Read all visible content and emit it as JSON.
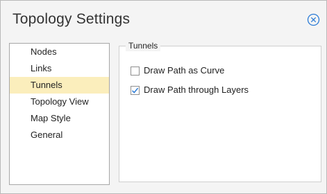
{
  "dialog": {
    "title": "Topology Settings",
    "close_icon": "close-circle-icon",
    "accent_color": "#2b7bd6"
  },
  "sidebar": {
    "items": [
      {
        "label": "Nodes",
        "selected": false
      },
      {
        "label": "Links",
        "selected": false
      },
      {
        "label": "Tunnels",
        "selected": true
      },
      {
        "label": "Topology View",
        "selected": false
      },
      {
        "label": "Map Style",
        "selected": false
      },
      {
        "label": "General",
        "selected": false
      }
    ],
    "selected_color": "#fbeebc"
  },
  "tunnels": {
    "legend": "Tunnels",
    "options": [
      {
        "label": "Draw Path as Curve",
        "checked": false
      },
      {
        "label": "Draw Path through Layers",
        "checked": true
      }
    ]
  }
}
